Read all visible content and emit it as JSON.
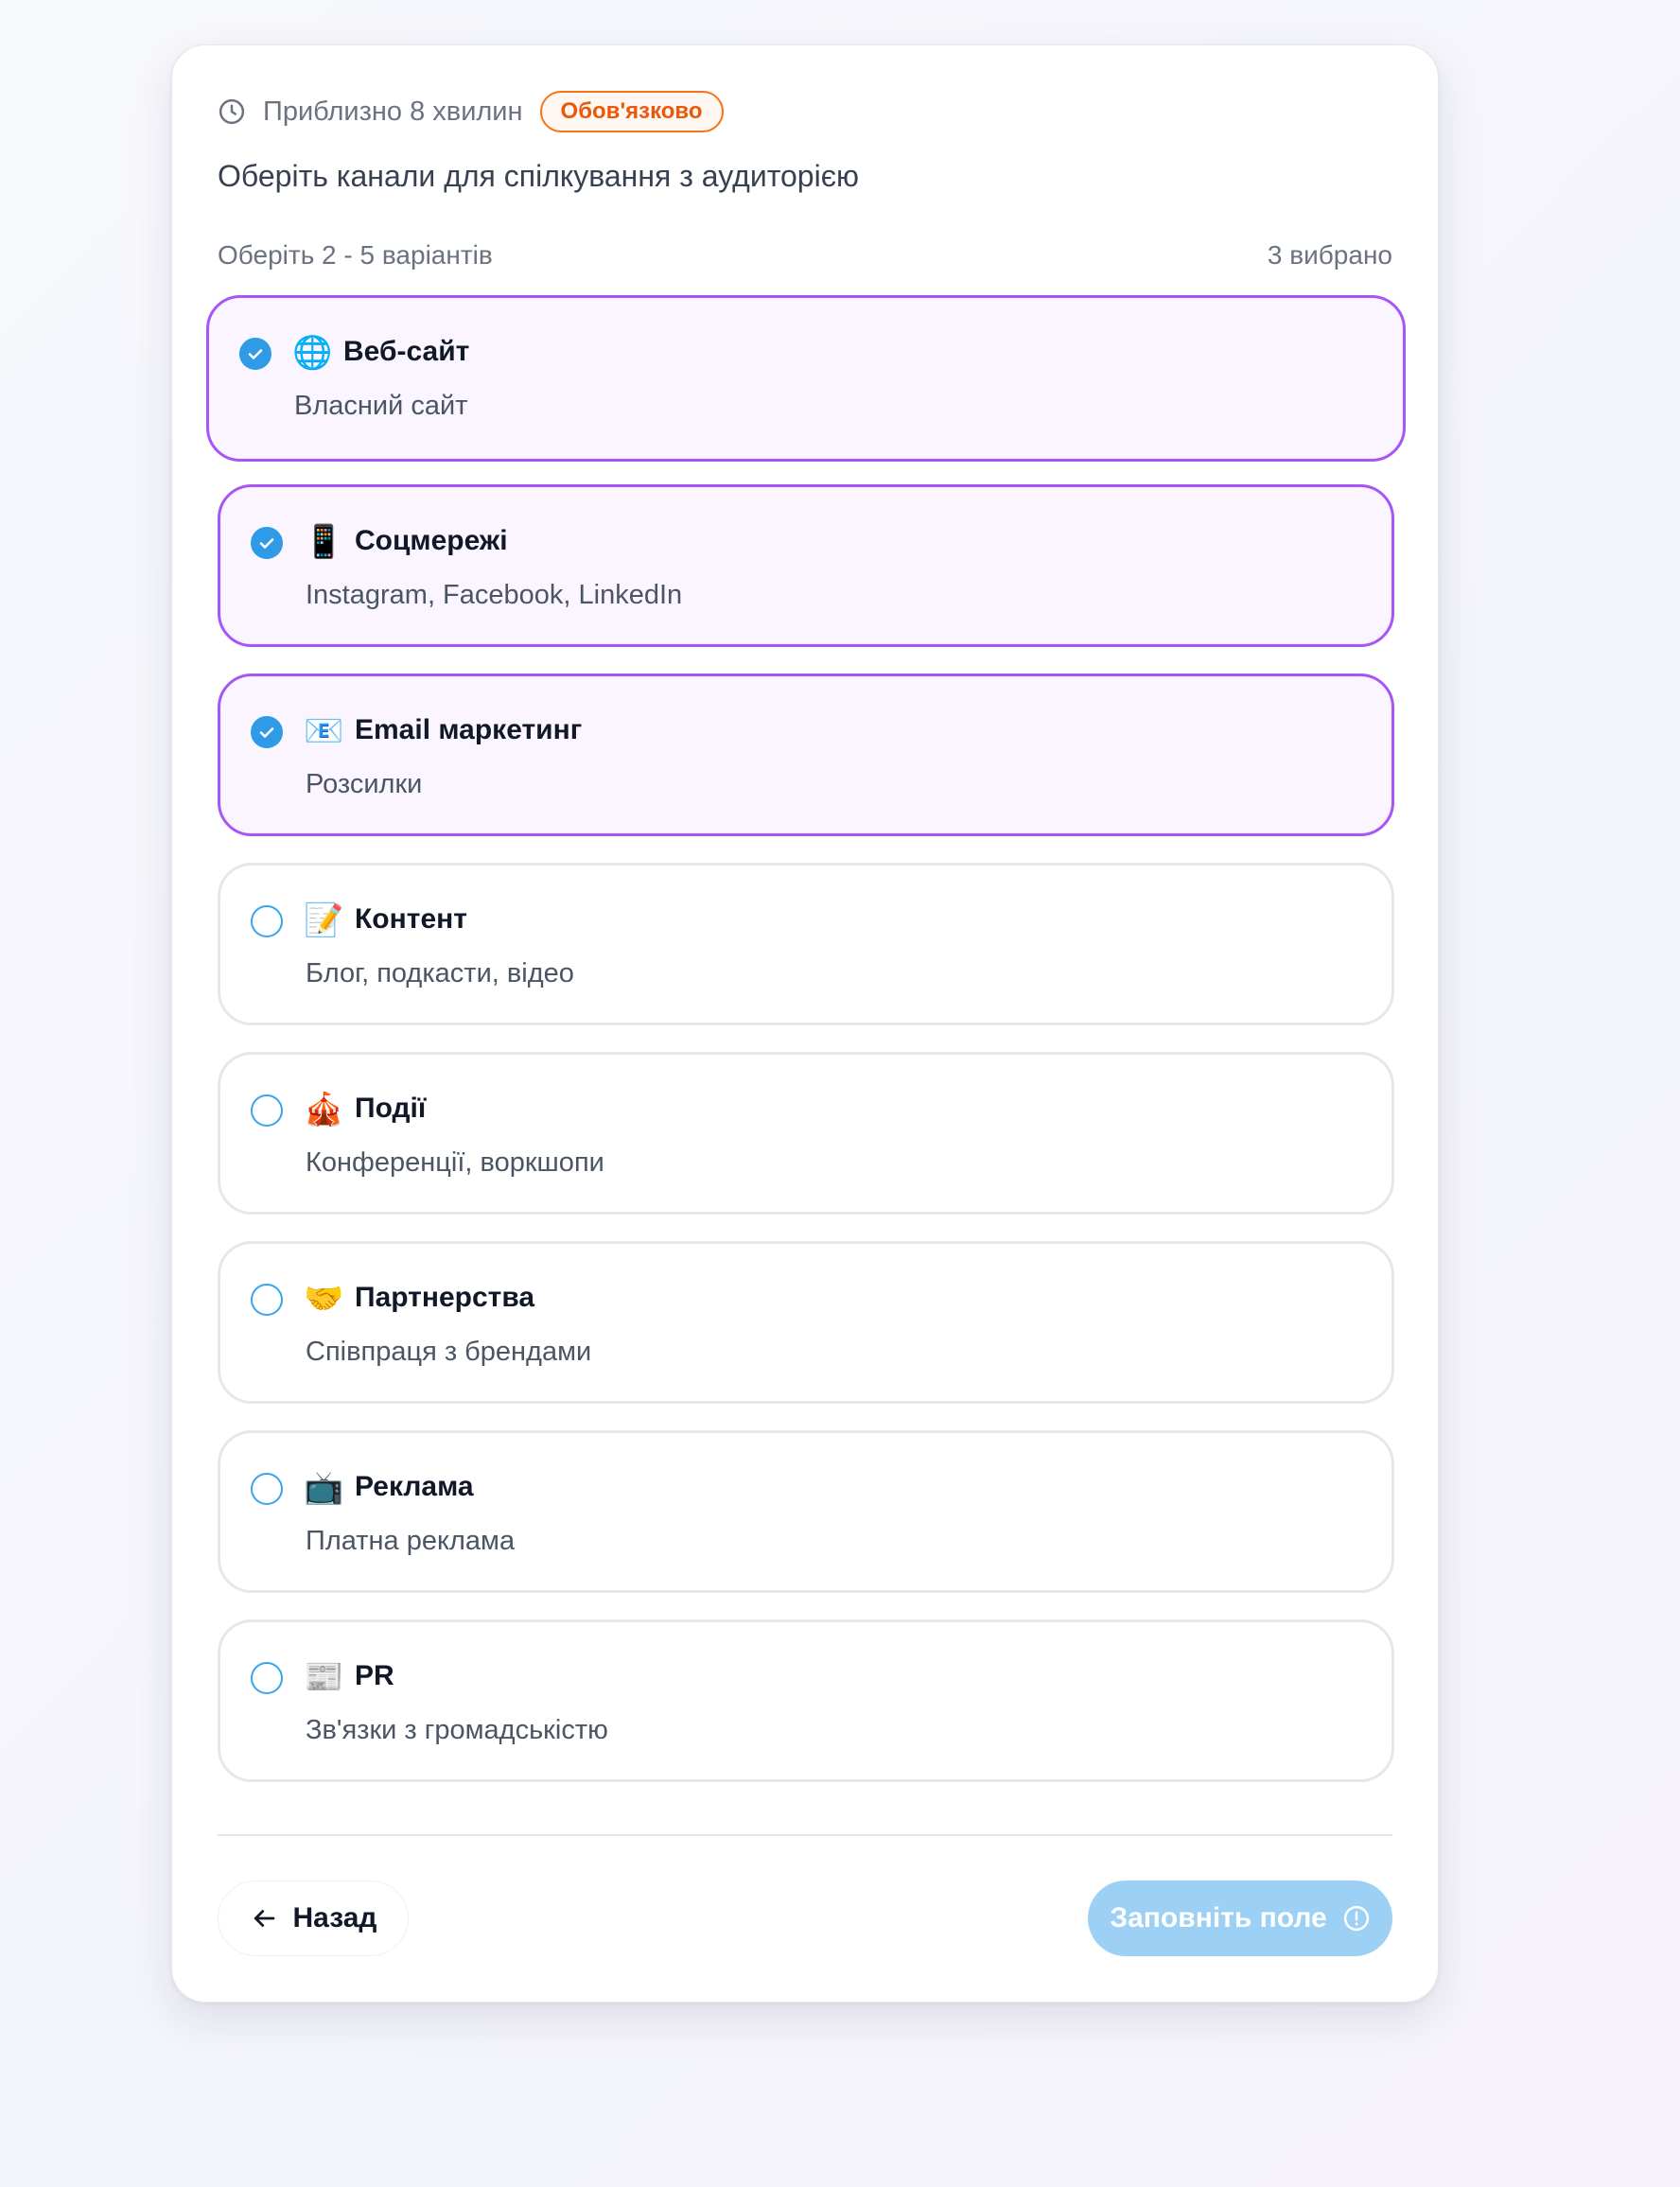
{
  "question": {
    "time_estimate": "Приблизно 8 хвилин",
    "required_badge": "Обов'язково",
    "text": "Оберіть канали для спілкування з аудиторією",
    "hint": "Оберіть 2 - 5 варіантів",
    "selected_count": "3 вибрано"
  },
  "options": [
    {
      "icon": "🌐",
      "title": "Веб-сайт",
      "desc": "Власний сайт",
      "selected": true
    },
    {
      "icon": "📱",
      "title": "Соцмережі",
      "desc": "Instagram, Facebook, LinkedIn",
      "selected": true
    },
    {
      "icon": "📧",
      "title": "Email маркетинг",
      "desc": "Розсилки",
      "selected": true
    },
    {
      "icon": "📝",
      "title": "Контент",
      "desc": "Блог, подкасти, відео",
      "selected": false
    },
    {
      "icon": "🎪",
      "title": "Події",
      "desc": "Конференції, воркшопи",
      "selected": false
    },
    {
      "icon": "🤝",
      "title": "Партнерства",
      "desc": "Співпраця з брендами",
      "selected": false
    },
    {
      "icon": "📺",
      "title": "Реклама",
      "desc": "Платна реклама",
      "selected": false
    },
    {
      "icon": "📰",
      "title": "PR",
      "desc": "Зв'язки з громадськістю",
      "selected": false
    }
  ],
  "footer": {
    "back_label": "Назад",
    "submit_label": "Заповніть поле"
  },
  "colors": {
    "selected_border": "#a855f7",
    "selected_bg": "#faf5fe",
    "check_blue": "#2f9be6",
    "badge_orange": "#f97316",
    "submit_disabled": "#9dd0f5"
  },
  "icons": {
    "time": "clock-icon",
    "back": "arrow-left-icon",
    "submit": "info-circle-icon",
    "check": "check-icon"
  }
}
